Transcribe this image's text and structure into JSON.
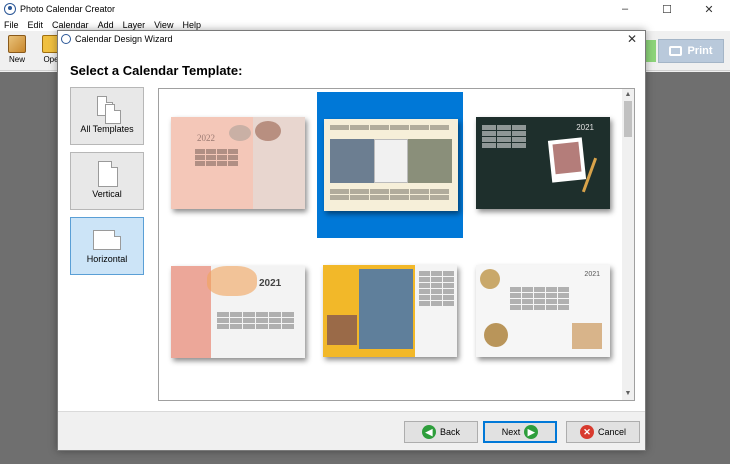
{
  "app": {
    "title": "Photo Calendar Creator",
    "window_controls": {
      "minimize": "–",
      "maximize": "☐",
      "close": "✕"
    }
  },
  "menu": [
    "File",
    "Edit",
    "Calendar",
    "Add",
    "Layer",
    "View",
    "Help"
  ],
  "toolbar": {
    "new_label": "New",
    "open_label": "Ope",
    "print_label": "Print"
  },
  "dialog": {
    "title": "Calendar Design Wizard",
    "close": "✕",
    "heading": "Select a Calendar Template:",
    "categories": [
      {
        "label": "All Templates",
        "selected": false
      },
      {
        "label": "Vertical",
        "selected": false
      },
      {
        "label": "Horizontal",
        "selected": true
      }
    ],
    "templates": [
      {
        "id": "t1",
        "text": "2022",
        "selected": false
      },
      {
        "id": "t2",
        "text": "",
        "selected": true
      },
      {
        "id": "t3",
        "text": "2021",
        "selected": false
      },
      {
        "id": "t4",
        "text": "2021",
        "selected": false
      },
      {
        "id": "t5",
        "text": "",
        "selected": false
      },
      {
        "id": "t6",
        "text": "2021",
        "selected": false
      }
    ],
    "scroll": {
      "up": "▲",
      "down": "▼"
    },
    "buttons": {
      "back": "Back",
      "next": "Next",
      "cancel": "Cancel"
    }
  },
  "colors": {
    "selection": "#0078d7",
    "print_button": "#b9c9db",
    "green": "#2e9e3c",
    "red": "#d83a2e"
  }
}
